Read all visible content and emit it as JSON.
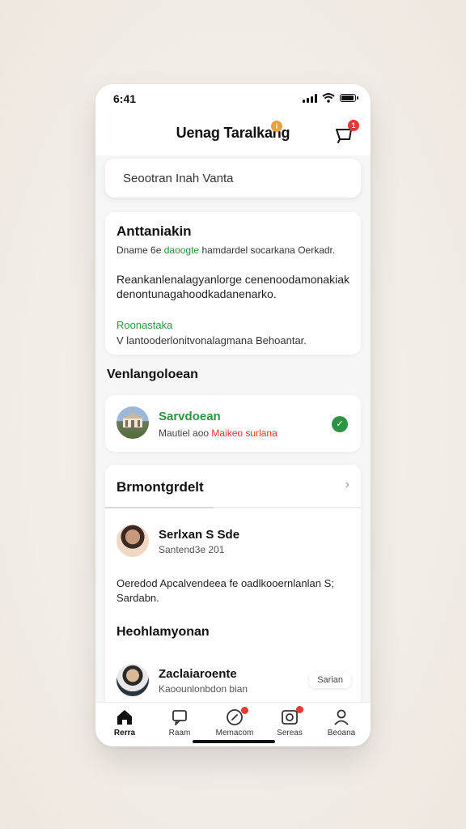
{
  "status_bar": {
    "time": "6:41"
  },
  "header": {
    "title": "Uenag Taralkang",
    "title_badge": "i",
    "notification_badge": "1"
  },
  "search": {
    "placeholder": "Seootran Inah Vanta"
  },
  "card_about": {
    "title": "Anttaniakin",
    "subtitle_gray": "Dname 6e",
    "subtitle_green": "daoogte",
    "subtitle_rest": "hamdardel socarkana Oerkadr.",
    "body": "Reankanlenalagyanlorge cenenoodamonakiak denontunagahoodkadanenarko.",
    "link": "Roonastaka",
    "footer": "V lantooderlonitvonalagmana Behoantar."
  },
  "section": {
    "title": "Venlangoloean"
  },
  "card_verified": {
    "name": "Sarvdoean",
    "meta_gray": "Mautiel aoo",
    "meta_red": "Maikeo surlana",
    "check": "✓"
  },
  "card_feed": {
    "title": "Brmontgrdelt",
    "chevron": "›",
    "post": {
      "author": "Serlxan S Sde",
      "date": "Santend3e 201",
      "body": "Oeredod Apcalvendeea fe oadlkooernlanlan S; Sardabn."
    },
    "subheading": "Heohlamyonan",
    "person": {
      "name": "Zaclaiaroente",
      "meta": "Kaoounlonbdon bian",
      "button": "Sarian"
    }
  },
  "tabbar": {
    "items": [
      {
        "label": "Rerra",
        "icon": "home-icon",
        "active": true
      },
      {
        "label": "Raam",
        "icon": "chat-icon",
        "active": false
      },
      {
        "label": "Memacom",
        "icon": "compose-icon",
        "active": false
      },
      {
        "label": "Sereas",
        "icon": "camera-icon",
        "active": false
      },
      {
        "label": "Beoana",
        "icon": "profile-icon",
        "active": false
      }
    ]
  },
  "colors": {
    "accent_green": "#2e9444",
    "badge_red": "#e53935",
    "badge_orange": "#e9a23b"
  }
}
